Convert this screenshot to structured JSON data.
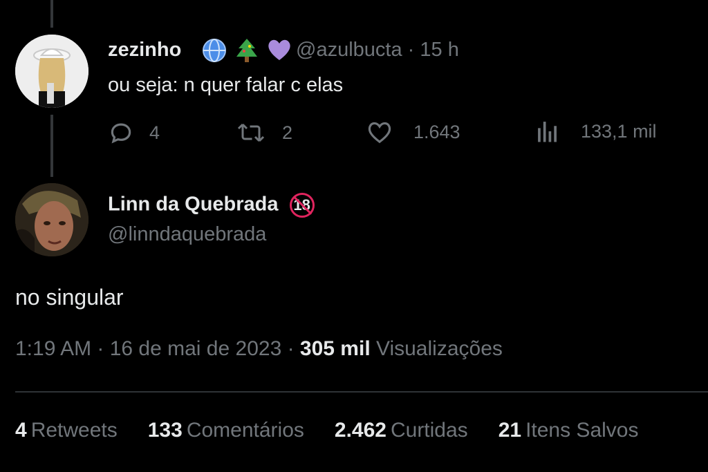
{
  "reply_tweet": {
    "author_name": "zezinho",
    "emojis": [
      "globe-icon",
      "christmas-tree-icon",
      "purple-heart-icon"
    ],
    "handle": "@azulbucta",
    "separator": "·",
    "time": "15 h",
    "text": "ou seja: n quer falar c elas",
    "actions": {
      "replies": "4",
      "retweets": "2",
      "likes": "1.643",
      "views": "133,1 mil"
    }
  },
  "main_tweet": {
    "author_name": "Linn da Quebrada",
    "badge": "18",
    "handle": "@linndaquebrada",
    "text": "no singular",
    "timestamp": "1:19 AM · 16 de mai de 2023 · ",
    "views_count": "305 mil",
    "views_label": " Visualizações"
  },
  "stats": [
    {
      "count": "4",
      "label": "Retweets"
    },
    {
      "count": "133",
      "label": "Comentários"
    },
    {
      "count": "2.462",
      "label": "Curtidas"
    },
    {
      "count": "21",
      "label": "Itens Salvos"
    }
  ],
  "colors": {
    "background": "#000000",
    "text_primary": "#e7e9ea",
    "text_secondary": "#71767b",
    "divider": "#2f3336",
    "badge_red": "#e0245e"
  }
}
